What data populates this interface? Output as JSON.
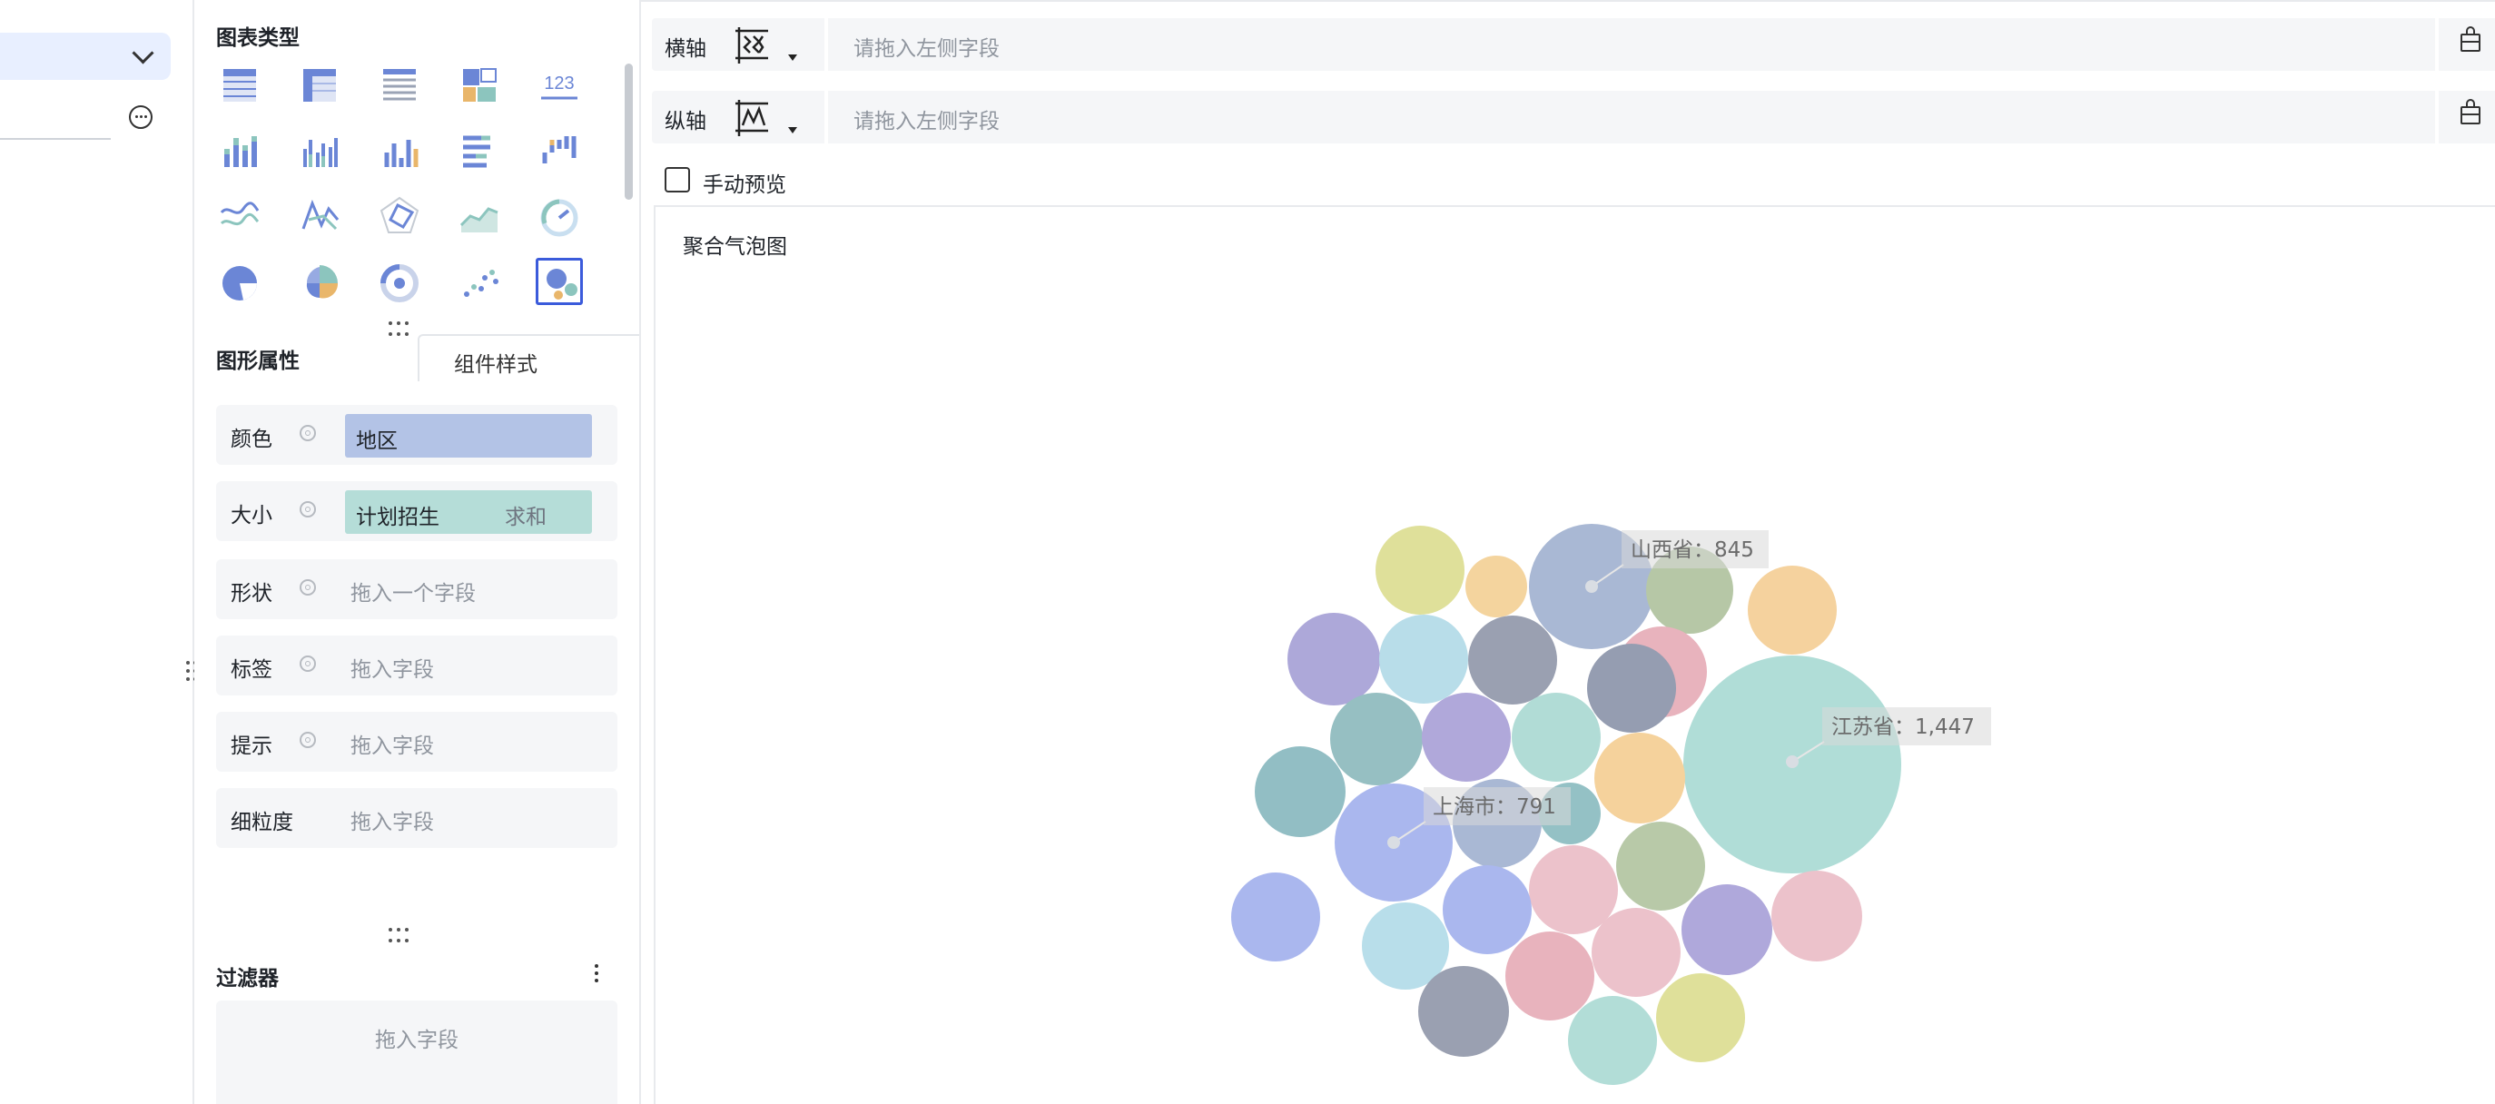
{
  "panel": {
    "chart_types_title": "图表类型",
    "chart_type_icons": [
      "table-icon",
      "cross-table-icon",
      "detail-table-icon",
      "treemap-icon",
      "kpi-number-icon",
      "stacked-column-icon",
      "grouped-column-icon",
      "column-icon",
      "bar-icon",
      "waterfall-icon",
      "multi-line-icon",
      "line-icon",
      "radar-icon",
      "area-icon",
      "gauge-icon",
      "pie-icon",
      "rose-pie-icon",
      "donut-icon",
      "scatter-icon",
      "bubble-icon"
    ],
    "kpi_text": "123",
    "tab_props": "图形属性",
    "tab_style": "组件样式",
    "props": [
      {
        "label": "颜色",
        "value": "地区",
        "placeholder": "",
        "agg": "",
        "gear": true
      },
      {
        "label": "大小",
        "value": "计划招生",
        "placeholder": "",
        "agg": "求和",
        "gear": true
      },
      {
        "label": "形状",
        "value": "",
        "placeholder": "拖入一个字段",
        "agg": "",
        "gear": true
      },
      {
        "label": "标签",
        "value": "",
        "placeholder": "拖入字段",
        "agg": "",
        "gear": true
      },
      {
        "label": "提示",
        "value": "",
        "placeholder": "拖入字段",
        "agg": "",
        "gear": true
      },
      {
        "label": "细粒度",
        "value": "",
        "placeholder": "拖入字段",
        "agg": "",
        "gear": false
      }
    ],
    "filter_title": "过滤器",
    "filter_placeholder": "拖入字段"
  },
  "axes": {
    "x_label": "横轴",
    "y_label": "纵轴",
    "placeholder": "请拖入左侧字段"
  },
  "manual_preview": "手动预览",
  "chart_name": "聚合气泡图",
  "colors": {
    "accent": "#3b5bdb",
    "pill_color": "#b3c3e6",
    "pill_size": "#b5ddd8"
  },
  "chart_data": {
    "type": "bubble",
    "title": "",
    "labels": [
      {
        "name": "山西省",
        "value": "845"
      },
      {
        "name": "江苏省",
        "value": "1,447"
      },
      {
        "name": "上海市",
        "value": "791"
      }
    ]
  }
}
